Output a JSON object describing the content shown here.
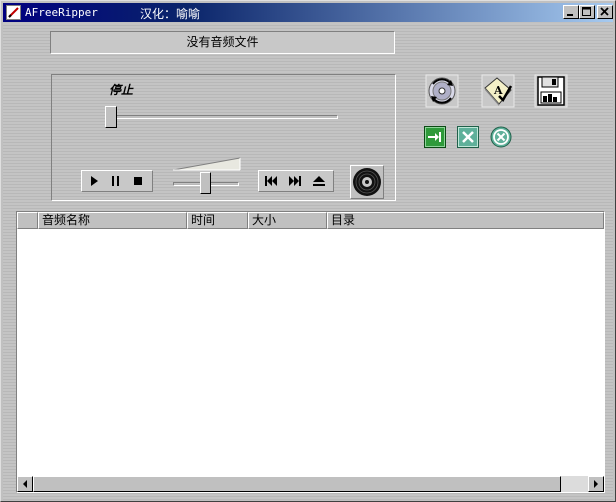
{
  "window": {
    "title": "AFreeRipper",
    "subtitle": "汉化：喻喻"
  },
  "status": {
    "message": "没有音频文件"
  },
  "player": {
    "state_label": "停止",
    "position_fraction": 0.0,
    "volume_fraction": 0.5
  },
  "list": {
    "columns": [
      "",
      "音频名称",
      "时间",
      "大小",
      "目录"
    ],
    "rows": []
  },
  "icons": {
    "cd_rip": "cd-refresh-icon",
    "tag": "tag-edit-icon",
    "save": "floppy-save-icon",
    "add": "add-arrow-icon",
    "remove": "remove-x-icon",
    "clear": "clear-circle-x-icon",
    "disc": "disc-icon"
  },
  "colors": {
    "title_start": "#000080",
    "title_end": "#a6caf0",
    "face": "#c0c0c0",
    "green_btn": "#2e9a3a",
    "teal_btn": "#5fb09a"
  }
}
